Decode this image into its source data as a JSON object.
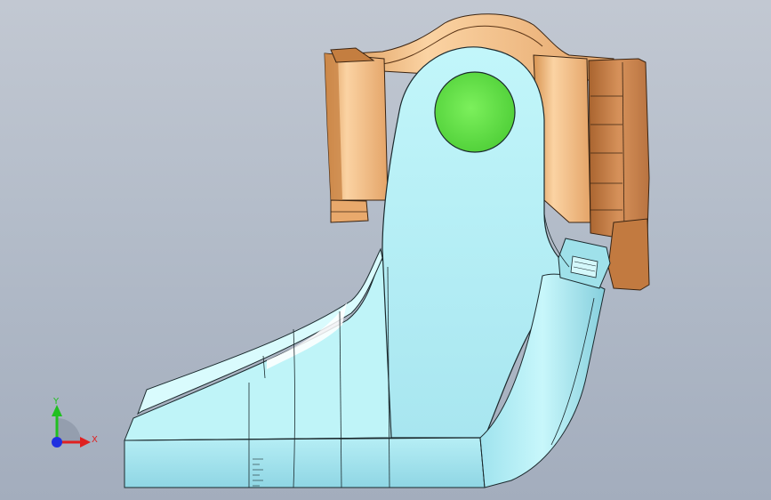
{
  "viewport": {
    "background_top": "#c2c8d2",
    "background_bottom": "#a3adbd"
  },
  "model": {
    "bracket_color": "#b8f0f4",
    "bracket_edge_color": "#1b2a2e",
    "yoke_color": "#e6a66a",
    "yoke_shadow_color": "#b06a34",
    "hole_color": "#6ee84f"
  },
  "triad": {
    "x_label": "X",
    "y_label": "Y",
    "x_color": "#e02020",
    "y_color": "#20c020",
    "z_color": "#2030e0"
  }
}
